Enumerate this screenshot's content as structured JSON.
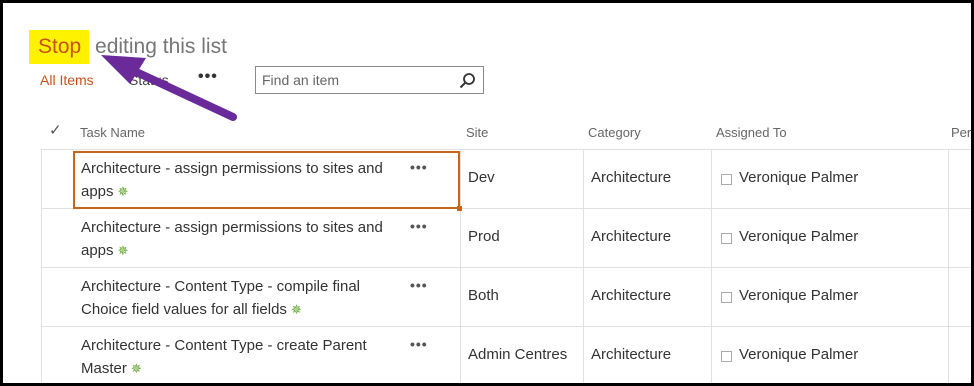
{
  "header": {
    "title_highlight": "Stop",
    "title_rest": " editing this list"
  },
  "views": {
    "all_items": "All Items",
    "status": "Status",
    "more": "•••"
  },
  "search": {
    "placeholder": "Find an item"
  },
  "table": {
    "columns": [
      "Task Name",
      "Site",
      "Category",
      "Assigned To",
      "Per"
    ],
    "rows": [
      {
        "task": "Architecture - assign permissions to sites and apps",
        "site": "Dev",
        "category": "Architecture",
        "assigned": "Veronique Palmer"
      },
      {
        "task": "Architecture - assign permissions to sites and apps",
        "site": "Prod",
        "category": "Architecture",
        "assigned": "Veronique Palmer"
      },
      {
        "task": "Architecture - Content Type - compile final Choice field values for all fields",
        "site": "Both",
        "category": "Architecture",
        "assigned": "Veronique Palmer"
      },
      {
        "task": "Architecture - Content Type - create Parent Master",
        "site": "Admin Centres",
        "category": "Architecture",
        "assigned": "Veronique Palmer"
      }
    ],
    "row_more": "•••",
    "new_marker": "✵"
  },
  "colors": {
    "accent": "#c8511a",
    "highlight": "#fff200",
    "arrow": "#6a2a9a",
    "new_marker": "#5da22a"
  }
}
